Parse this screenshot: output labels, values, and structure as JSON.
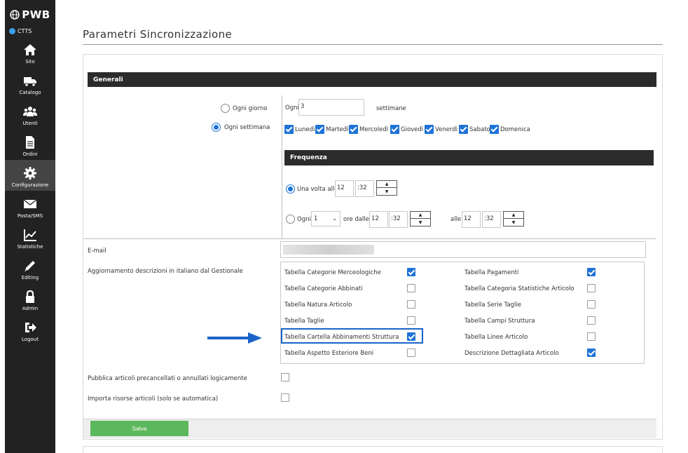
{
  "sidebar": {
    "logo": "PWB",
    "site_code": "CTTS",
    "items": [
      {
        "label": "Sito",
        "icon": "home-icon"
      },
      {
        "label": "Catalogo",
        "icon": "truck-icon"
      },
      {
        "label": "Utenti",
        "icon": "users-icon"
      },
      {
        "label": "Ordini",
        "icon": "document-icon"
      },
      {
        "label": "Configurazione",
        "icon": "gear-icon"
      },
      {
        "label": "Posta/SMS",
        "icon": "envelope-icon"
      },
      {
        "label": "Statistiche",
        "icon": "chart-icon"
      },
      {
        "label": "Editing",
        "icon": "pencil-icon"
      },
      {
        "label": "Admin",
        "icon": "lock-icon"
      },
      {
        "label": "Logout",
        "icon": "logout-icon"
      }
    ],
    "active_index": 4
  },
  "page": {
    "title": "Parametri Sincronizzazione"
  },
  "generali": {
    "section_title": "Generali",
    "radio_daily": "Ogni giorno",
    "radio_weekly": "Ogni settimana",
    "selected": "weekly",
    "ogni_label": "Ogni",
    "ogni_value": "3",
    "settimane_label": "settimane",
    "days": [
      "Lunedì",
      "Martedì",
      "Mercoledì",
      "Giovedì",
      "Venerdì",
      "Sabato",
      "Domenica"
    ]
  },
  "frequenza": {
    "section_title": "Frequenza",
    "once_label": "Una volta alle",
    "once_hour": "12",
    "once_min": "32",
    "every_label": "Ogni",
    "every_value": "1",
    "from_label": "ore dalle",
    "from_hour": "12",
    "from_min": "32",
    "to_label": "alle",
    "to_hour": "12",
    "to_min": "32",
    "colon": ":",
    "up_symbol": "▲",
    "down_symbol": "▼",
    "chevron": "⌄"
  },
  "email": {
    "label": "E-mail"
  },
  "aggiornamento": {
    "label": "Aggiornamento descrizioni in italiano dal Gestionale",
    "left": [
      {
        "label": "Tabella Categorie Merceologiche",
        "checked": true
      },
      {
        "label": "Tabella Categorie Abbinati",
        "checked": false
      },
      {
        "label": "Tabella Natura Articolo",
        "checked": false
      },
      {
        "label": "Tabella Taglie",
        "checked": false
      },
      {
        "label": "Tabella Cartella Abbinamenti Struttura",
        "checked": true
      },
      {
        "label": "Tabella Aspetto Esteriore Beni",
        "checked": false
      }
    ],
    "right": [
      {
        "label": "Tabella Pagamenti",
        "checked": true
      },
      {
        "label": "Tabella Categoria Statistiche Articolo",
        "checked": false
      },
      {
        "label": "Tabella Serie Taglie",
        "checked": false
      },
      {
        "label": "Tabella Campi Struttura",
        "checked": false
      },
      {
        "label": "Tabella Linee Articolo",
        "checked": false
      },
      {
        "label": "Descrizione Dettagliata Articolo",
        "checked": true
      }
    ]
  },
  "options": {
    "pubblica_label": "Pubblica articoli precancellati o annullati logicamente",
    "importa_label": "Importa risorse articoli (solo se automatica)"
  },
  "actions": {
    "save_label": "Salva"
  },
  "colors": {
    "accent": "#1e73d8",
    "save": "#5cb85c",
    "sidebar": "#222222",
    "section": "#2b2b2b"
  }
}
